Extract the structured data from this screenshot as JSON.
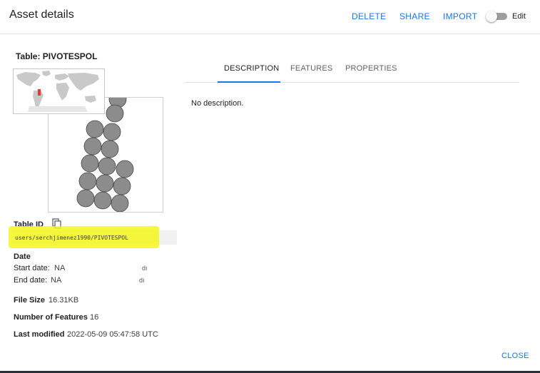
{
  "header": {
    "title": "Asset details",
    "delete_label": "DELETE",
    "share_label": "SHARE",
    "import_label": "IMPORT",
    "edit_label": "Edit",
    "edit_toggle_on": false
  },
  "asset": {
    "table_title": "Table: PIVOTESPOL",
    "table_id_label": "Table ID",
    "table_id": "users/serchjimenez1990/PIVOTESPOL",
    "date_label": "Date",
    "start_date_label": "Start date:",
    "start_date_value": "NA",
    "start_date_trailing": "dı",
    "end_date_label": "End date:",
    "end_date_value": "NA",
    "end_date_trailing": "dı",
    "file_size_label": "File Size",
    "file_size_value": "16.31KB",
    "num_features_label": "Number of Features",
    "num_features_value": "16",
    "last_modified_label": "Last modified",
    "last_modified_value": "2022-05-09 05:47:58 UTC"
  },
  "tabs": [
    {
      "label": "DESCRIPTION",
      "active": true
    },
    {
      "label": "FEATURES",
      "active": false
    },
    {
      "label": "PROPERTIES",
      "active": false
    }
  ],
  "description_text": "No description.",
  "footer": {
    "close_label": "CLOSE"
  },
  "colors": {
    "accent": "#1a73e8",
    "highlight": "#f4f614",
    "shape_fill": "#8c8c8c",
    "map_marker": "#e53935"
  },
  "icons": {
    "copy": "copy-icon",
    "toggle": "toggle-switch"
  }
}
